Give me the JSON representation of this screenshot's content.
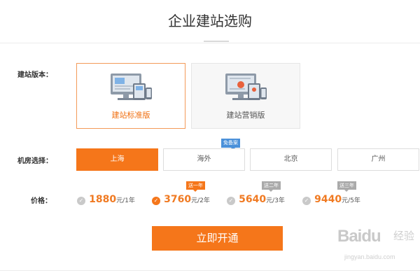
{
  "page": {
    "title": "企业建站选购"
  },
  "version": {
    "label": "建站版本：",
    "options": [
      {
        "label": "建站标准版",
        "selected": true
      },
      {
        "label": "建站营销版",
        "selected": false
      }
    ]
  },
  "room": {
    "label": "机房选择：",
    "badge": "免备案",
    "options": [
      {
        "label": "上海",
        "selected": true
      },
      {
        "label": "海外",
        "selected": false
      },
      {
        "label": "北京",
        "selected": false
      },
      {
        "label": "广州",
        "selected": false
      }
    ]
  },
  "price": {
    "label": "价格：",
    "options": [
      {
        "value": "1880",
        "unit": "元/1年",
        "promo": "",
        "selected": false
      },
      {
        "value": "3760",
        "unit": "元/2年",
        "promo": "送一年",
        "selected": true
      },
      {
        "value": "5640",
        "unit": "元/3年",
        "promo": "送二年",
        "selected": false
      },
      {
        "value": "9440",
        "unit": "元/5年",
        "promo": "送三年",
        "selected": false
      }
    ]
  },
  "actions": {
    "submit": "立即开通"
  },
  "watermark": {
    "brand": "Baidu",
    "cn": "经验",
    "url": "jingyan.baidu.com"
  },
  "colors": {
    "accent": "#f5761a",
    "badge_blue": "#4a90d9",
    "border": "#dddddd"
  }
}
